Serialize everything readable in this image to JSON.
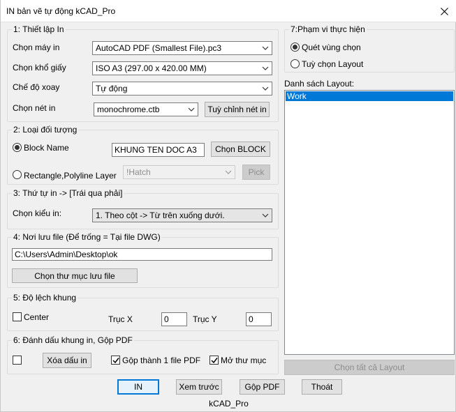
{
  "window": {
    "title": "IN bản vẽ tự động kCAD_Pro",
    "footer": "kCAD_Pro"
  },
  "group1": {
    "label": "1: Thiết lập In",
    "printer_label": "Chọn máy in",
    "printer_value": "AutoCAD PDF (Smallest File).pc3",
    "paper_label": "Chọn khổ giấy",
    "paper_value": "ISO A3 (297.00 x 420.00 MM)",
    "rotate_label": "Chế độ xoay",
    "rotate_value": "Tự động",
    "pen_label": "Chọn nét in",
    "pen_value": "monochrome.ctb",
    "pen_button": "Tuỳ chỉnh nét in"
  },
  "group2": {
    "label": "2: Loại đối tượng",
    "block_radio": "Block Name",
    "block_value": "KHUNG TEN DOC A3",
    "block_button": "Chọn BLOCK",
    "rect_radio": "Rectangle,Polyline Layer",
    "layer_value": "!Hatch",
    "pick_button": "Pick"
  },
  "group3": {
    "label": "3: Thứ tự in -> [Trái qua phải]",
    "order_label": "Chọn kiểu in:",
    "order_value": "1. Theo cột -> Từ trên xuống dưới."
  },
  "group4": {
    "label": "4: Nơi lưu file (Để trống = Tại file DWG)",
    "path_value": "C:\\Users\\Admin\\Desktop\\ok",
    "folder_button": "Chọn thư mục lưu file"
  },
  "group5": {
    "label": "5: Độ lệch khung",
    "center_label": "Center",
    "x_label": "Trục X",
    "x_value": "0",
    "y_label": "Trục Y",
    "y_value": "0"
  },
  "group6": {
    "label": "6: Đánh dấu khung in, Gộp PDF",
    "clear_button": "Xóa dấu in",
    "merge_label": "Gộp thành 1 file PDF",
    "open_label": "Mở thư mục"
  },
  "group7": {
    "label": "7:Phạm vi thực hiện",
    "sweep_radio": "Quét vùng chọn",
    "layout_radio": "Tuỳ chọn Layout"
  },
  "layouts": {
    "label": "Danh sách Layout:",
    "items": [
      "Work"
    ],
    "select_all_button": "Chọn tất cả Layout"
  },
  "actions": {
    "print": "IN",
    "preview": "Xem trước",
    "merge": "Gộp PDF",
    "exit": "Thoát"
  },
  "colors": {
    "accent": "#0078d7"
  },
  "icons": [
    "close-icon",
    "chevron-down-icon",
    "checkmark-icon"
  ]
}
